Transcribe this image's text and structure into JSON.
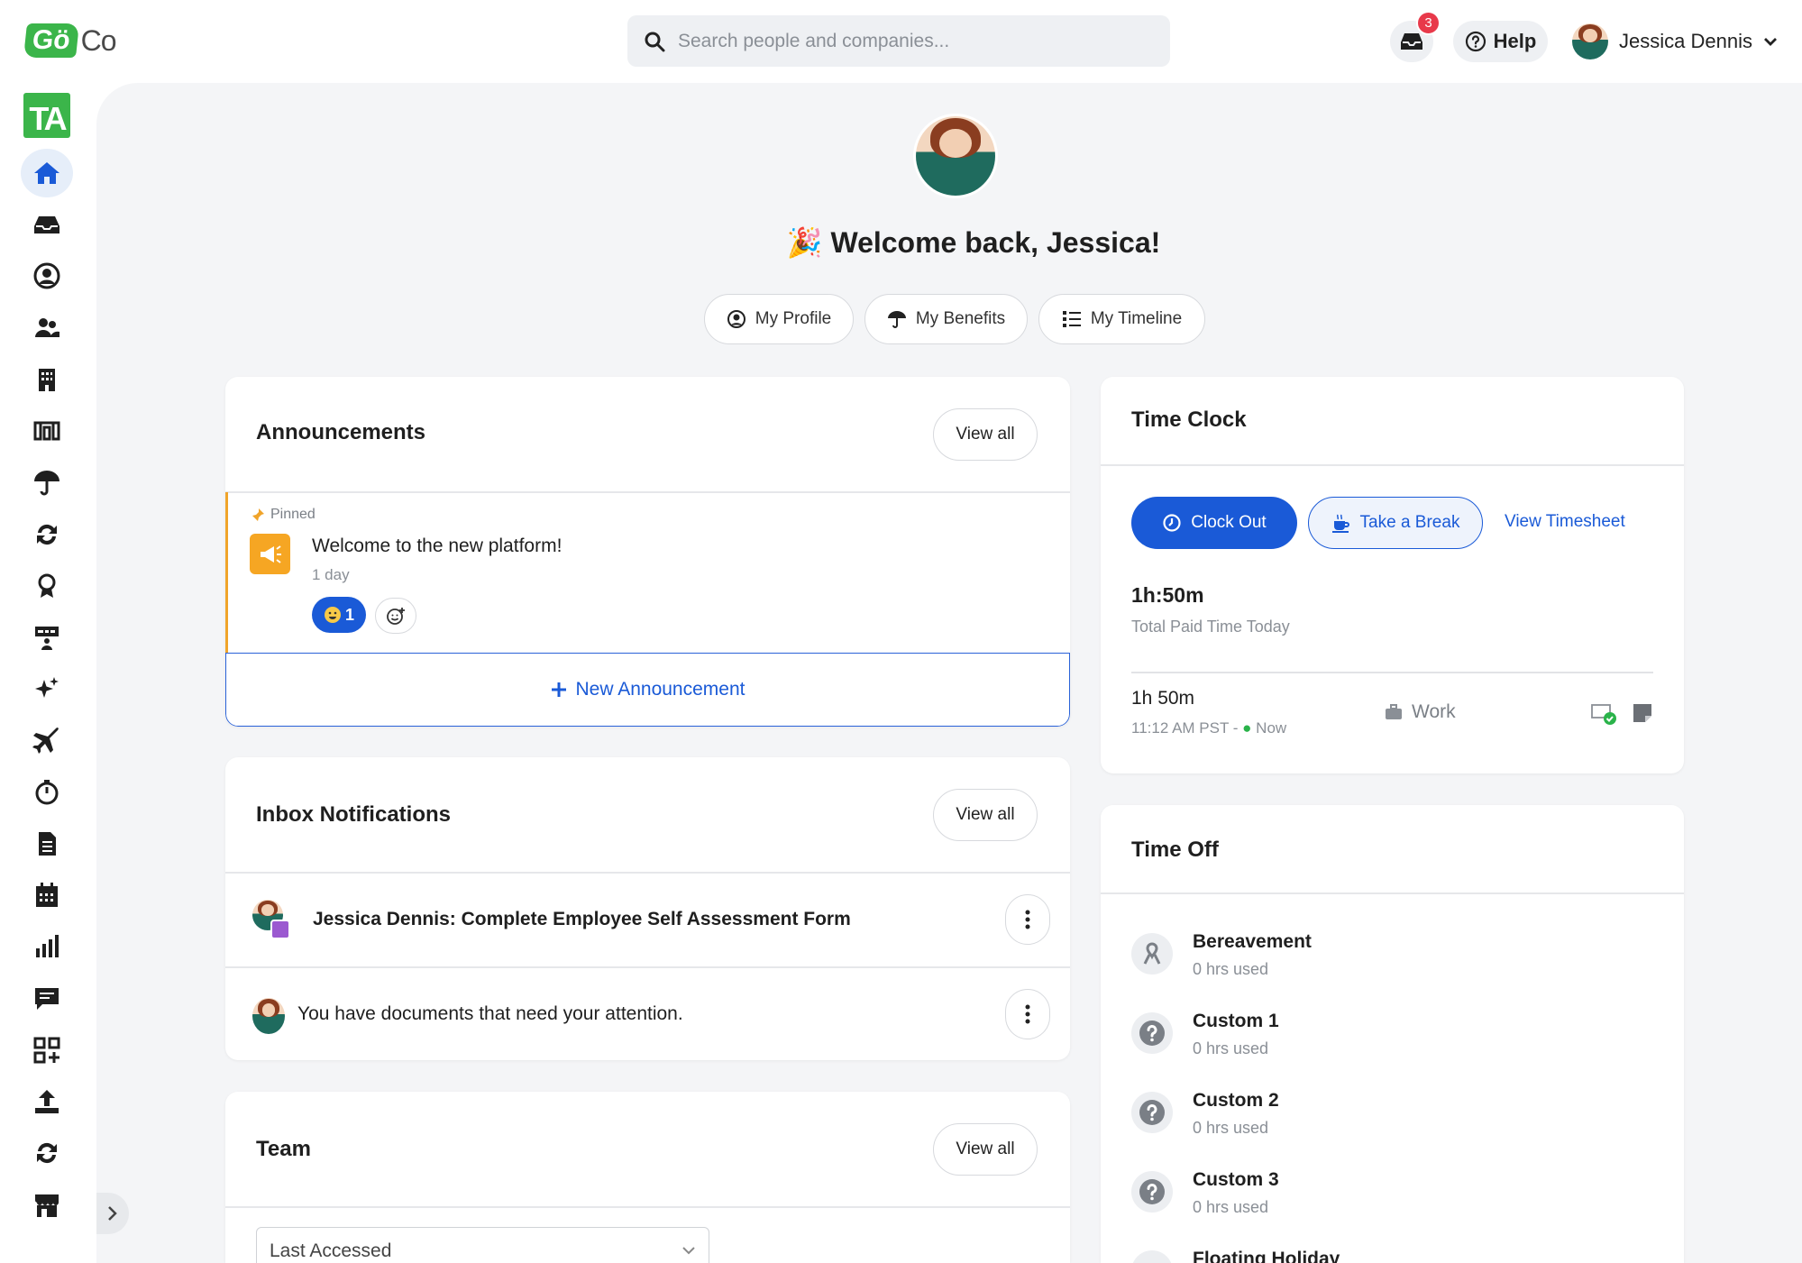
{
  "brand": {
    "logo_go": "Gö",
    "logo_co": "Co",
    "app_logo": "TA"
  },
  "topbar": {
    "search_placeholder": "Search people and companies...",
    "inbox_count": "3",
    "help_label": "Help",
    "user_name": "Jessica Dennis"
  },
  "hero": {
    "welcome": "🎉 Welcome back, Jessica!",
    "buttons": [
      "My Profile",
      "My Benefits",
      "My Timeline"
    ]
  },
  "announcements": {
    "title": "Announcements",
    "view_all": "View all",
    "pinned_label": "Pinned",
    "item_title": "Welcome to the new platform!",
    "item_time": "1 day",
    "reaction_count": "1",
    "new_label": "New Announcement"
  },
  "inbox": {
    "title": "Inbox Notifications",
    "view_all": "View all",
    "items": [
      "Jessica Dennis: Complete Employee Self Assessment Form",
      "You have documents that need your attention."
    ]
  },
  "team": {
    "title": "Team",
    "view_all": "View all",
    "filter": "Last Accessed"
  },
  "time_clock": {
    "title": "Time Clock",
    "clock_out": "Clock Out",
    "take_break": "Take a Break",
    "view_timesheet": "View Timesheet",
    "total_value": "1h:50m",
    "total_label": "Total Paid Time Today",
    "entry_duration": "1h 50m",
    "entry_range_start": "11:12 AM PST - ",
    "entry_range_end": "Now",
    "entry_type": "Work"
  },
  "time_off": {
    "title": "Time Off",
    "items": [
      {
        "name": "Bereavement",
        "used": "0 hrs used"
      },
      {
        "name": "Custom 1",
        "used": "0 hrs used"
      },
      {
        "name": "Custom 2",
        "used": "0 hrs used"
      },
      {
        "name": "Custom 3",
        "used": "0 hrs used"
      },
      {
        "name": "Floating Holiday",
        "used": ""
      }
    ]
  },
  "colors": {
    "accent": "#1a5ad7",
    "brand_green": "#3bb54a",
    "pin": "#f0a42a",
    "badge": "#e8394a"
  }
}
